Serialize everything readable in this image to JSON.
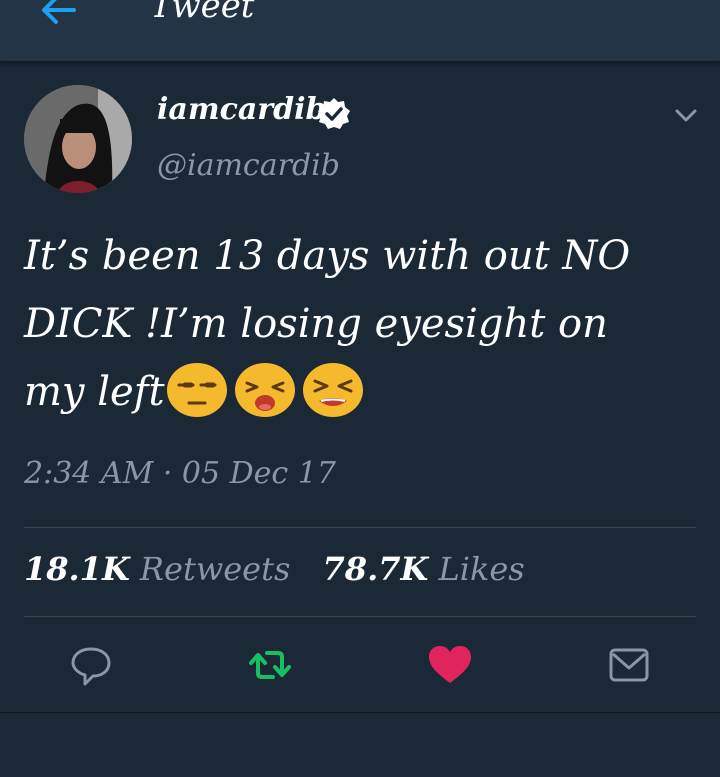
{
  "header": {
    "title": "Tweet",
    "back_icon": "back-arrow-icon"
  },
  "tweet": {
    "author": {
      "name": "iamcardib",
      "handle": "@iamcardib",
      "verified": true,
      "avatar": "avatar-photo"
    },
    "text_line_1": "It’s been 13 days with out NO",
    "text_line_2": "DICK !I’m losing eyesight on",
    "text_line_3": "my left",
    "emojis": [
      "unamused-face",
      "tired-face",
      "persevering-face"
    ],
    "timestamp": "2:34 AM · 05 Dec 17",
    "retweets_count": "18.1K",
    "retweets_label": "Retweets",
    "likes_count": "78.7K",
    "likes_label": "Likes"
  },
  "actions": {
    "reply_icon": "reply-icon",
    "retweet_icon": "retweet-icon",
    "like_icon": "heart-icon",
    "dm_icon": "mail-icon"
  },
  "colors": {
    "background": "#1b2836",
    "header": "#243447",
    "accent_blue": "#1da1f2",
    "retweet_green": "#17bf63",
    "like_red": "#e0245e",
    "muted_text": "#8899a6"
  }
}
